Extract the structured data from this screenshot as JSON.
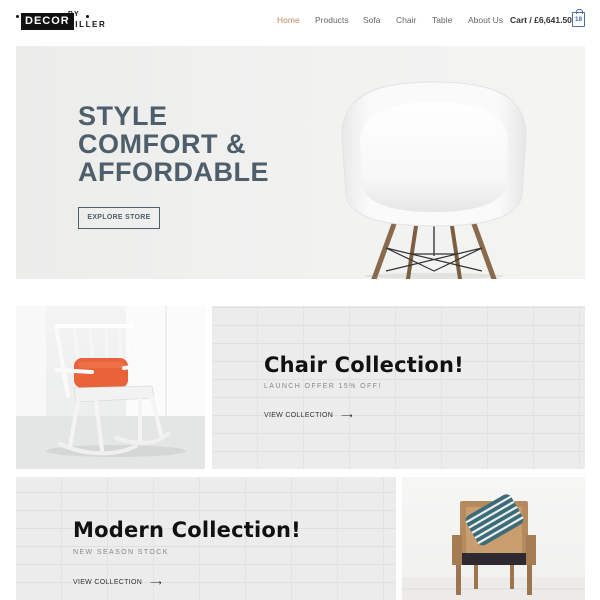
{
  "brand": {
    "primary": "DECOR",
    "by": "BY",
    "secondary": "MILLER"
  },
  "nav": {
    "items": [
      {
        "label": "Home",
        "active": true
      },
      {
        "label": "Products",
        "active": false
      },
      {
        "label": "Sofa",
        "active": false
      },
      {
        "label": "Chair",
        "active": false
      },
      {
        "label": "Table",
        "active": false
      },
      {
        "label": "About Us",
        "active": false
      }
    ],
    "cart_label": "Cart / £6,641.50",
    "cart_count": "18"
  },
  "hero": {
    "title_lines": [
      "STYLE",
      "COMFORT &",
      "AFFORDABLE"
    ],
    "button_label": "EXPLORE STORE"
  },
  "chair_collection": {
    "title": "Chair Collection!",
    "subtitle": "LAUNCH OFFER 15% OFF!",
    "link": "VIEW COLLECTION"
  },
  "modern_collection": {
    "title": "Modern Collection!",
    "subtitle": "NEW SEASON STOCK",
    "link": "VIEW COLLECTION"
  },
  "colors": {
    "accent": "#c9865a",
    "heading": "#4e5e6b",
    "cart_icon": "#4c6ea8",
    "cushion": "#e8623a"
  },
  "icons": [
    "shopping-bag-icon",
    "arrow-right-icon"
  ]
}
